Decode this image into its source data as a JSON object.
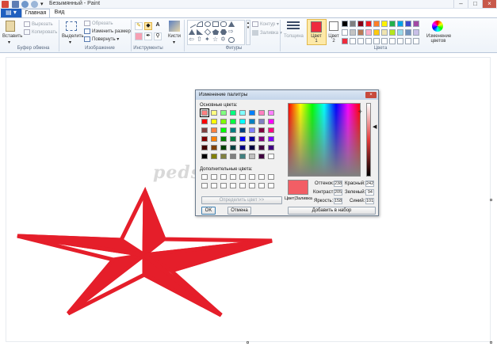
{
  "window": {
    "title": "Безымянный - Paint"
  },
  "tabs": [
    {
      "label": "Главная",
      "active": true
    },
    {
      "label": "Вид",
      "active": false
    }
  ],
  "clipboard": {
    "paste": "Вставить",
    "cut": "Вырезать",
    "copy": "Копировать",
    "group": "Буфер обмена"
  },
  "image": {
    "select": "Выделить",
    "crop": "Обрезать",
    "resize": "Изменить размер",
    "rotate": "Повернуть",
    "group": "Изображение"
  },
  "tools": {
    "group": "Инструменты",
    "text_tool": "A",
    "brushes": "Кисти"
  },
  "shapes": {
    "outline": "Контур",
    "fill": "Заливка",
    "group": "Фигуры"
  },
  "colors": {
    "thickness": "Толщина",
    "color1": "Цвет\n1",
    "color2": "Цвет\n2",
    "edit": "Изменение цветов",
    "group": "Цвета",
    "color1_value": "#ee2b3c",
    "palette": [
      "#000000",
      "#7f7f7f",
      "#880015",
      "#ed1c24",
      "#ff7f27",
      "#fff200",
      "#22b14c",
      "#00a2e8",
      "#3f48cc",
      "#a349a4",
      "#ffffff",
      "#c3c3c3",
      "#b97a57",
      "#ffaec9",
      "#ffc90e",
      "#efe4b0",
      "#b5e61d",
      "#99d9ea",
      "#7092be",
      "#c8bfe7",
      "#ee2b3c",
      "#ffffff",
      "#ffffff",
      "#ffffff",
      "#ffffff",
      "#ffffff",
      "#ffffff",
      "#ffffff",
      "#ffffff",
      "#ffffff"
    ]
  },
  "dialog": {
    "title": "Изменение палитры",
    "basic_colors_label": "Основные цвета:",
    "custom_colors_label": "Дополнительные цвета:",
    "define_button": "Определить цвет >>",
    "ok_button": "OK",
    "cancel_button": "Отмена",
    "add_button": "Добавить в набор",
    "color_solid_label": "Цвет|Заливка",
    "hue_label": "Оттенок:",
    "hue_value": "238",
    "sat_label": "Контраст:",
    "sat_value": "205",
    "lum_label": "Яркость:",
    "lum_value": "158",
    "red_label": "Красный:",
    "red_value": "242",
    "green_label": "Зеленый:",
    "green_value": "94",
    "blue_label": "Синий:",
    "blue_value": "101",
    "preview_color": "#f25e65",
    "basic_colors": [
      "#ff8080",
      "#ffff80",
      "#80ff80",
      "#00ff80",
      "#80ffff",
      "#0080ff",
      "#ff80c0",
      "#ff80ff",
      "#ff0000",
      "#ffff00",
      "#80ff00",
      "#00ff40",
      "#00ffff",
      "#0080c0",
      "#8080c0",
      "#ff00ff",
      "#804040",
      "#ff8040",
      "#00ff00",
      "#008080",
      "#004080",
      "#8080ff",
      "#800040",
      "#ff0080",
      "#800000",
      "#ff8000",
      "#008000",
      "#008040",
      "#0000ff",
      "#0000a0",
      "#800080",
      "#8000ff",
      "#400000",
      "#804000",
      "#004000",
      "#004040",
      "#000080",
      "#000040",
      "#400040",
      "#400080",
      "#000000",
      "#808000",
      "#808040",
      "#808080",
      "#408080",
      "#c0c0c0",
      "#400040",
      "#ffffff"
    ]
  },
  "canvas": {
    "star_color": "#e51e2a"
  },
  "watermark": "pedsovet.su"
}
